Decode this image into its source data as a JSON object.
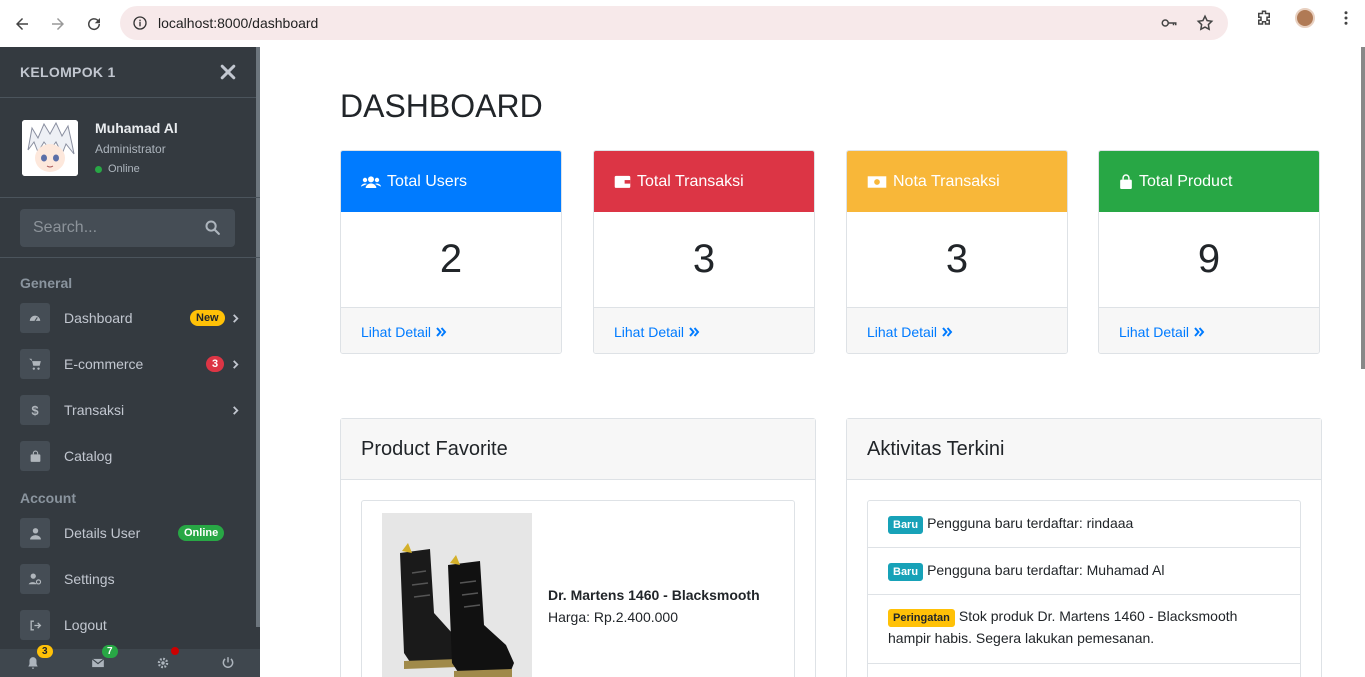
{
  "browser": {
    "url": "localhost:8000/dashboard"
  },
  "sidebar": {
    "brand": "KELOMPOK 1",
    "user": {
      "name": "Muhamad Al",
      "role": "Administrator",
      "status": "Online"
    },
    "search_placeholder": "Search...",
    "sections": [
      {
        "title": "General"
      },
      {
        "title": "Account"
      }
    ],
    "items": [
      {
        "label": "Dashboard",
        "badge": "New"
      },
      {
        "label": "E-commerce",
        "badge": "3"
      },
      {
        "label": "Transaksi"
      },
      {
        "label": "Catalog"
      },
      {
        "label": "Details User",
        "badge": "Online"
      },
      {
        "label": "Settings"
      },
      {
        "label": "Logout"
      }
    ],
    "footer": {
      "notifications": "3",
      "messages": "7"
    }
  },
  "main": {
    "title": "DASHBOARD",
    "cards": [
      {
        "label": "Total Users",
        "value": "2",
        "link": "Lihat Detail",
        "color": "#007bff"
      },
      {
        "label": "Total Transaksi",
        "value": "3",
        "link": "Lihat Detail",
        "color": "#dc3545"
      },
      {
        "label": "Nota Transaksi",
        "value": "3",
        "link": "Lihat Detail",
        "color": "#f8b739"
      },
      {
        "label": "Total Product",
        "value": "9",
        "link": "Lihat Detail",
        "color": "#28a745"
      }
    ],
    "favorite": {
      "title": "Product Favorite",
      "product_name": "Dr. Martens 1460 - Blacksmooth",
      "product_price": "Harga: Rp.2.400.000"
    },
    "activity": {
      "title": "Aktivitas Terkini",
      "items": [
        {
          "tag": "Baru",
          "text": "Pengguna baru terdaftar: rindaaa"
        },
        {
          "tag": "Baru",
          "text": "Pengguna baru terdaftar: Muhamad Al"
        },
        {
          "tag": "Peringatan",
          "text": "Stok produk Dr. Martens 1460 - Blacksmooth hampir habis. Segera lakukan pemesanan."
        }
      ]
    }
  }
}
